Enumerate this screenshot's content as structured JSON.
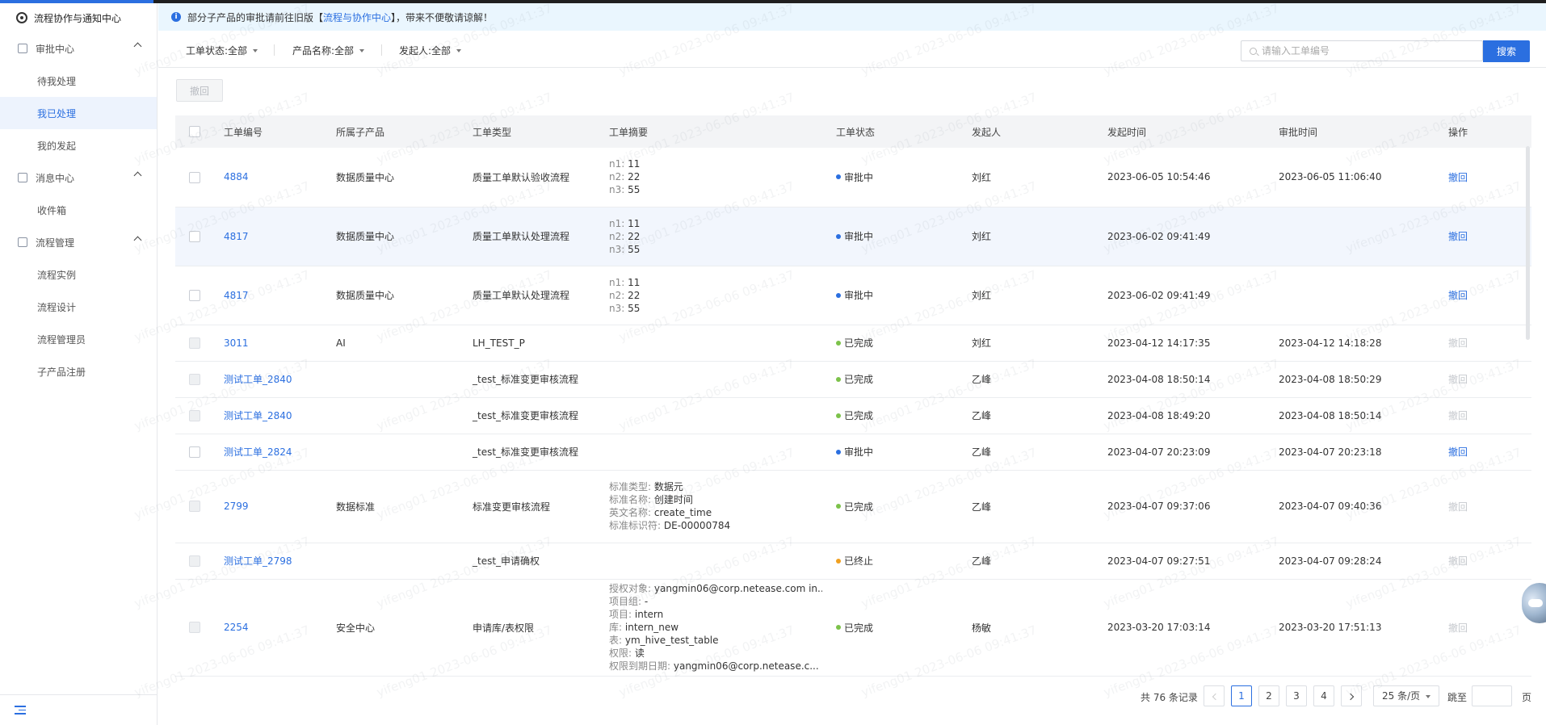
{
  "sidebar": {
    "title": "流程协作与通知中心",
    "groups": [
      {
        "label": "审批中心",
        "icon": "audit-icon",
        "items": [
          "待我处理",
          "我已处理",
          "我的发起"
        ]
      },
      {
        "label": "消息中心",
        "icon": "message-icon",
        "items": [
          "收件箱"
        ]
      },
      {
        "label": "流程管理",
        "icon": "process-icon",
        "items": [
          "流程实例",
          "流程设计",
          "流程管理员",
          "子产品注册"
        ]
      }
    ],
    "active_item": "我已处理"
  },
  "notice": {
    "prefix": "部分子产品的审批请前往旧版【",
    "link": "流程与协作中心",
    "suffix": "】，带来不便敬请谅解！"
  },
  "filters": {
    "status": "工单状态:全部",
    "product": "产品名称:全部",
    "initiator": "发起人:全部"
  },
  "search": {
    "placeholder": "请输入工单编号",
    "button": "搜索"
  },
  "toolbar": {
    "withdraw": "撤回"
  },
  "table": {
    "headers": [
      "工单编号",
      "所属子产品",
      "工单类型",
      "工单摘要",
      "工单状态",
      "发起人",
      "发起时间",
      "审批时间",
      "操作"
    ],
    "rows": [
      {
        "id": "4884",
        "product": "数据质量中心",
        "type": "质量工单默认验收流程",
        "summary": [
          [
            "n1:",
            "11"
          ],
          [
            "n2:",
            "22"
          ],
          [
            "n3:",
            "55"
          ]
        ],
        "status": "审批中",
        "status_color": "#2b6fe0",
        "initiator": "刘红",
        "start": "2023-06-05 10:54:46",
        "approve": "2023-06-05 11:06:40",
        "action": "撤回",
        "enabled": true
      },
      {
        "id": "4817",
        "product": "数据质量中心",
        "type": "质量工单默认处理流程",
        "summary": [
          [
            "n1:",
            "11"
          ],
          [
            "n2:",
            "22"
          ],
          [
            "n3:",
            "55"
          ]
        ],
        "status": "审批中",
        "status_color": "#2b6fe0",
        "initiator": "刘红",
        "start": "2023-06-02 09:41:49",
        "approve": "",
        "action": "撤回",
        "enabled": true
      },
      {
        "id": "4817",
        "product": "数据质量中心",
        "type": "质量工单默认处理流程",
        "summary": [
          [
            "n1:",
            "11"
          ],
          [
            "n2:",
            "22"
          ],
          [
            "n3:",
            "55"
          ]
        ],
        "status": "审批中",
        "status_color": "#2b6fe0",
        "initiator": "刘红",
        "start": "2023-06-02 09:41:49",
        "approve": "",
        "action": "撤回",
        "enabled": true
      },
      {
        "id": "3011",
        "product": "AI",
        "type": "LH_TEST_P",
        "summary": [],
        "status": "已完成",
        "status_color": "#7cc24a",
        "initiator": "刘红",
        "start": "2023-04-12 14:17:35",
        "approve": "2023-04-12 14:18:28",
        "action": "撤回",
        "enabled": false
      },
      {
        "id": "测试工单_2840",
        "product": "",
        "type": "_test_标准变更审核流程",
        "summary": [],
        "status": "已完成",
        "status_color": "#7cc24a",
        "initiator": "乙峰",
        "start": "2023-04-08 18:50:14",
        "approve": "2023-04-08 18:50:29",
        "action": "撤回",
        "enabled": false
      },
      {
        "id": "测试工单_2840",
        "product": "",
        "type": "_test_标准变更审核流程",
        "summary": [],
        "status": "已完成",
        "status_color": "#7cc24a",
        "initiator": "乙峰",
        "start": "2023-04-08 18:49:20",
        "approve": "2023-04-08 18:50:14",
        "action": "撤回",
        "enabled": false
      },
      {
        "id": "测试工单_2824",
        "product": "",
        "type": "_test_标准变更审核流程",
        "summary": [],
        "status": "审批中",
        "status_color": "#2b6fe0",
        "initiator": "乙峰",
        "start": "2023-04-07 20:23:09",
        "approve": "2023-04-07 20:23:18",
        "action": "撤回",
        "enabled": true
      },
      {
        "id": "2799",
        "product": "数据标准",
        "type": "标准变更审核流程",
        "summary": [
          [
            "标准类型:",
            "数据元"
          ],
          [
            "标准名称:",
            "创建时间"
          ],
          [
            "英文名称:",
            "create_time"
          ],
          [
            "标准标识符:",
            "DE-00000784"
          ]
        ],
        "status": "已完成",
        "status_color": "#7cc24a",
        "initiator": "乙峰",
        "start": "2023-04-07 09:37:06",
        "approve": "2023-04-07 09:40:36",
        "action": "撤回",
        "enabled": false
      },
      {
        "id": "测试工单_2798",
        "product": "",
        "type": "_test_申请确权",
        "summary": [],
        "status": "已终止",
        "status_color": "#f0a020",
        "initiator": "乙峰",
        "start": "2023-04-07 09:27:51",
        "approve": "2023-04-07 09:28:24",
        "action": "撤回",
        "enabled": false
      },
      {
        "id": "2254",
        "product": "安全中心",
        "type": "申请库/表权限",
        "summary": [
          [
            "授权对象:",
            "yangmin06@corp.netease.com in..."
          ],
          [
            "项目组:",
            "-"
          ],
          [
            "项目:",
            "intern"
          ],
          [
            "库:",
            "intern_new"
          ],
          [
            "表:",
            "ym_hive_test_table"
          ],
          [
            "权限:",
            "读"
          ],
          [
            "权限到期日期:",
            "yangmin06@corp.netease.c..."
          ]
        ],
        "status": "已完成",
        "status_color": "#7cc24a",
        "initiator": "杨敏",
        "start": "2023-03-20 17:03:14",
        "approve": "2023-03-20 17:51:13",
        "action": "撤回",
        "enabled": false
      }
    ]
  },
  "pagination": {
    "total": "共 76 条记录",
    "pages": [
      "1",
      "2",
      "3",
      "4"
    ],
    "current": "1",
    "page_size": "25 条/页",
    "jump_label": "跳至",
    "page_unit": "页"
  },
  "watermark": "yifeng01 2023-06-06 09:41:37",
  "colors": {
    "accent": "#2b6fe0",
    "notice_bg": "#eaf6fe",
    "active_bg": "#edf3fd"
  }
}
